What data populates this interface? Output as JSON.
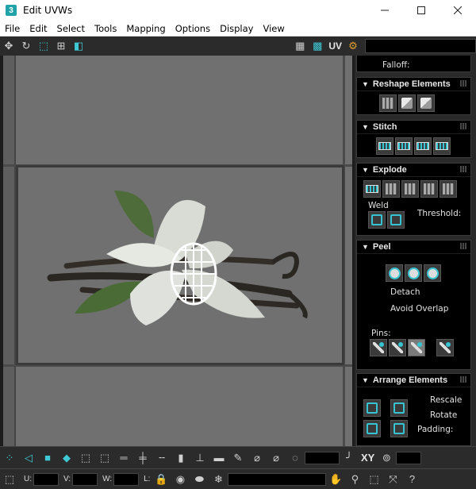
{
  "window": {
    "title": "Edit UVWs",
    "app_icon": "3",
    "controls": [
      "minimize-icon",
      "maximize-icon",
      "close-icon"
    ]
  },
  "menu": [
    "File",
    "Edit",
    "Select",
    "Tools",
    "Mapping",
    "Options",
    "Display",
    "View"
  ],
  "toolbar": {
    "uv_label": "UV",
    "accent_color": "#3fc9d6"
  },
  "panel": {
    "falloff_label": "Falloff:",
    "reshape": {
      "title": "Reshape Elements"
    },
    "stitch": {
      "title": "Stitch"
    },
    "explode": {
      "title": "Explode",
      "weld_label": "Weld",
      "threshold_label": "Threshold:"
    },
    "peel": {
      "title": "Peel",
      "detach_label": "Detach",
      "avoid_overlap_label": "Avoid Overlap",
      "pins_label": "Pins:"
    },
    "arrange": {
      "title": "Arrange Elements",
      "rescale_label": "Rescale",
      "rotate_label": "Rotate",
      "padding_label": "Padding:"
    }
  },
  "bottom": {
    "xy_label": "XY",
    "u_label": "U:",
    "v_label": "V:",
    "w_label": "W:",
    "l_label": "L:"
  }
}
